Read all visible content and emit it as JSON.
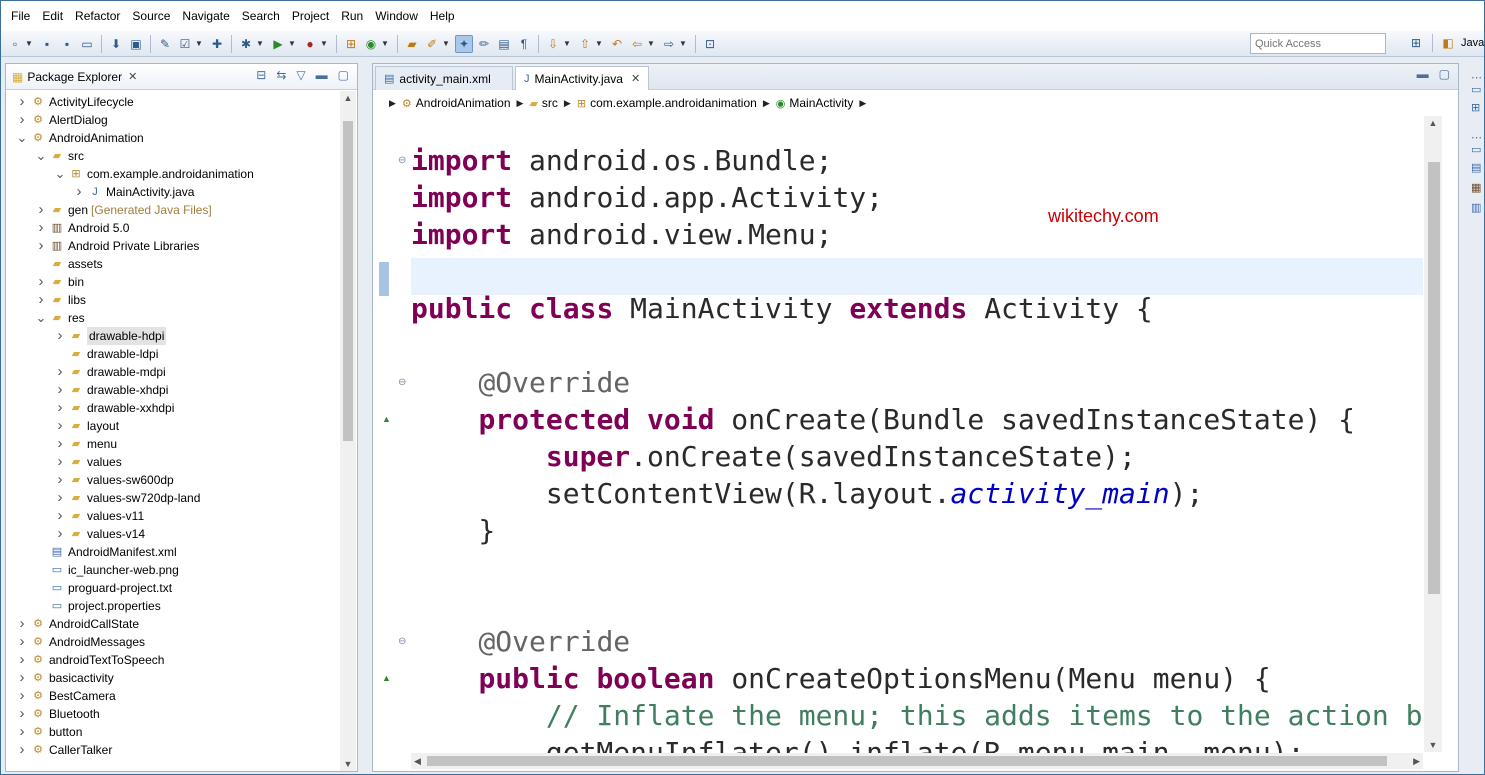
{
  "menu": [
    "File",
    "Edit",
    "Refactor",
    "Source",
    "Navigate",
    "Search",
    "Project",
    "Run",
    "Window",
    "Help"
  ],
  "toolbar": {
    "quick_access_placeholder": "Quick Access",
    "perspective": "Java"
  },
  "package_explorer": {
    "title": "Package Explorer",
    "close": "✕",
    "tree": [
      {
        "label": "ActivityLifecycle",
        "depth": 0,
        "twisty": "closed",
        "icon": "project-icon"
      },
      {
        "label": "AlertDialog",
        "depth": 0,
        "twisty": "closed",
        "icon": "project-icon"
      },
      {
        "label": "AndroidAnimation",
        "depth": 0,
        "twisty": "open",
        "icon": "project-icon"
      },
      {
        "label": "src",
        "depth": 1,
        "twisty": "open",
        "icon": "source-folder-icon"
      },
      {
        "label": "com.example.androidanimation",
        "depth": 2,
        "twisty": "open",
        "icon": "package-icon"
      },
      {
        "label": "MainActivity.java",
        "depth": 3,
        "twisty": "closed",
        "icon": "java-file-icon"
      },
      {
        "label": "gen",
        "decoration": "[Generated Java Files]",
        "depth": 1,
        "twisty": "closed",
        "icon": "source-folder-icon"
      },
      {
        "label": "Android 5.0",
        "depth": 1,
        "twisty": "closed",
        "icon": "library-icon"
      },
      {
        "label": "Android Private Libraries",
        "depth": 1,
        "twisty": "closed",
        "icon": "library-icon"
      },
      {
        "label": "assets",
        "depth": 1,
        "twisty": "none",
        "icon": "folder-icon"
      },
      {
        "label": "bin",
        "depth": 1,
        "twisty": "closed",
        "icon": "folder-icon"
      },
      {
        "label": "libs",
        "depth": 1,
        "twisty": "closed",
        "icon": "folder-icon"
      },
      {
        "label": "res",
        "depth": 1,
        "twisty": "open",
        "icon": "folder-icon"
      },
      {
        "label": "drawable-hdpi",
        "depth": 2,
        "twisty": "closed",
        "icon": "folder-icon",
        "selected": true
      },
      {
        "label": "drawable-ldpi",
        "depth": 2,
        "twisty": "none",
        "icon": "folder-icon"
      },
      {
        "label": "drawable-mdpi",
        "depth": 2,
        "twisty": "closed",
        "icon": "folder-icon"
      },
      {
        "label": "drawable-xhdpi",
        "depth": 2,
        "twisty": "closed",
        "icon": "folder-icon"
      },
      {
        "label": "drawable-xxhdpi",
        "depth": 2,
        "twisty": "closed",
        "icon": "folder-icon"
      },
      {
        "label": "layout",
        "depth": 2,
        "twisty": "closed",
        "icon": "folder-icon"
      },
      {
        "label": "menu",
        "depth": 2,
        "twisty": "closed",
        "icon": "folder-icon"
      },
      {
        "label": "values",
        "depth": 2,
        "twisty": "closed",
        "icon": "folder-icon"
      },
      {
        "label": "values-sw600dp",
        "depth": 2,
        "twisty": "closed",
        "icon": "folder-icon"
      },
      {
        "label": "values-sw720dp-land",
        "depth": 2,
        "twisty": "closed",
        "icon": "folder-icon"
      },
      {
        "label": "values-v11",
        "depth": 2,
        "twisty": "closed",
        "icon": "folder-icon"
      },
      {
        "label": "values-v14",
        "depth": 2,
        "twisty": "closed",
        "icon": "folder-icon"
      },
      {
        "label": "AndroidManifest.xml",
        "depth": 1,
        "twisty": "none",
        "icon": "xml-file-icon"
      },
      {
        "label": "ic_launcher-web.png",
        "depth": 1,
        "twisty": "none",
        "icon": "file-icon"
      },
      {
        "label": "proguard-project.txt",
        "depth": 1,
        "twisty": "none",
        "icon": "file-icon"
      },
      {
        "label": "project.properties",
        "depth": 1,
        "twisty": "none",
        "icon": "file-icon"
      },
      {
        "label": "AndroidCallState",
        "depth": 0,
        "twisty": "closed",
        "icon": "project-icon"
      },
      {
        "label": "AndroidMessages",
        "depth": 0,
        "twisty": "closed",
        "icon": "project-icon"
      },
      {
        "label": "androidTextToSpeech",
        "depth": 0,
        "twisty": "closed",
        "icon": "project-icon"
      },
      {
        "label": "basicactivity",
        "depth": 0,
        "twisty": "closed",
        "icon": "project-icon"
      },
      {
        "label": "BestCamera",
        "depth": 0,
        "twisty": "closed",
        "icon": "project-icon"
      },
      {
        "label": "Bluetooth",
        "depth": 0,
        "twisty": "closed",
        "icon": "project-icon"
      },
      {
        "label": "button",
        "depth": 0,
        "twisty": "closed",
        "icon": "project-icon"
      },
      {
        "label": "CallerTalker",
        "depth": 0,
        "twisty": "closed",
        "icon": "project-icon"
      }
    ]
  },
  "editor": {
    "tabs": [
      {
        "label": "activity_main.xml",
        "active": false
      },
      {
        "label": "MainActivity.java",
        "active": true
      }
    ],
    "tab_close": "✕",
    "breadcrumb": [
      "AndroidAnimation",
      "src",
      "com.example.androidanimation",
      "MainActivity"
    ],
    "watermark": "wikitechy.com",
    "code_lines": [
      [
        {
          "t": "import",
          "c": "kw"
        },
        {
          "t": " android.os.Bundle;",
          "c": ""
        }
      ],
      [
        {
          "t": "import",
          "c": "kw"
        },
        {
          "t": " android.app.Activity;",
          "c": ""
        }
      ],
      [
        {
          "t": "import",
          "c": "kw"
        },
        {
          "t": " android.view.Menu;",
          "c": ""
        }
      ],
      [],
      [
        {
          "t": "public",
          "c": "kw"
        },
        {
          "t": " ",
          "c": ""
        },
        {
          "t": "class",
          "c": "kw"
        },
        {
          "t": " MainActivity ",
          "c": ""
        },
        {
          "t": "extends",
          "c": "kw"
        },
        {
          "t": " Activity {",
          "c": ""
        }
      ],
      [],
      [
        {
          "t": "    ",
          "c": ""
        },
        {
          "t": "@Override",
          "c": "ann"
        }
      ],
      [
        {
          "t": "    ",
          "c": ""
        },
        {
          "t": "protected",
          "c": "kw"
        },
        {
          "t": " ",
          "c": ""
        },
        {
          "t": "void",
          "c": "kw"
        },
        {
          "t": " onCreate(Bundle savedInstanceState) {",
          "c": ""
        }
      ],
      [
        {
          "t": "        ",
          "c": ""
        },
        {
          "t": "super",
          "c": "kw"
        },
        {
          "t": ".onCreate(savedInstanceState);",
          "c": ""
        }
      ],
      [
        {
          "t": "        setContentView(R.layout.",
          "c": ""
        },
        {
          "t": "activity_main",
          "c": "ital"
        },
        {
          "t": ");",
          "c": ""
        }
      ],
      [
        {
          "t": "    }",
          "c": ""
        }
      ],
      [],
      [],
      [
        {
          "t": "    ",
          "c": ""
        },
        {
          "t": "@Override",
          "c": "ann"
        }
      ],
      [
        {
          "t": "    ",
          "c": ""
        },
        {
          "t": "public",
          "c": "kw"
        },
        {
          "t": " ",
          "c": ""
        },
        {
          "t": "boolean",
          "c": "kw"
        },
        {
          "t": " onCreateOptionsMenu(Menu menu) {",
          "c": ""
        }
      ],
      [
        {
          "t": "        ",
          "c": ""
        },
        {
          "t": "// Inflate the menu; this adds items to the action bar",
          "c": "cmt"
        }
      ],
      [
        {
          "t": "        getMenuInflater().inflate(R.menu.main, menu);",
          "c": ""
        }
      ]
    ]
  }
}
